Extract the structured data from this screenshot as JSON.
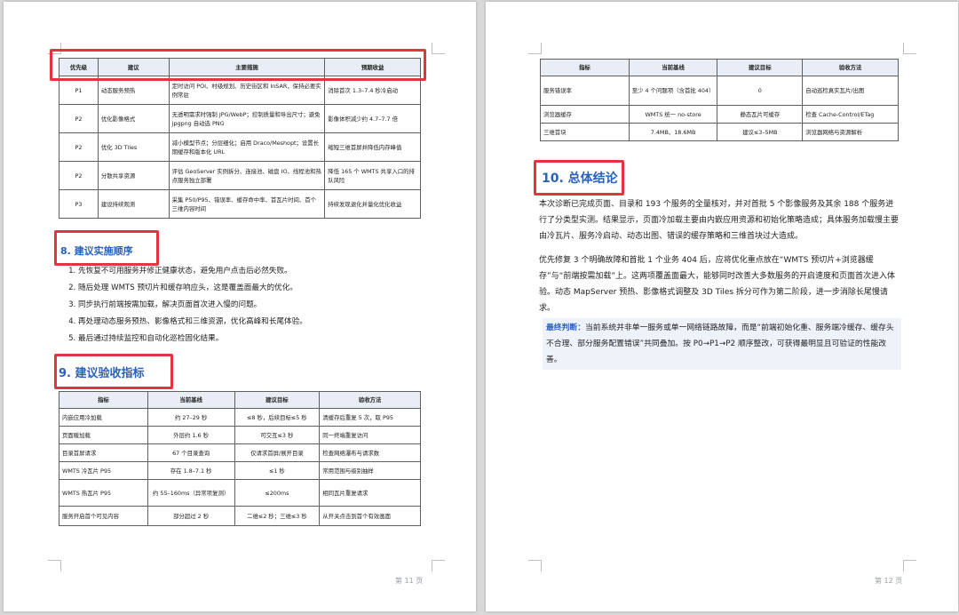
{
  "pages": [
    {
      "footer": "第 11 页",
      "table1": {
        "headers": [
          "优先级",
          "建议",
          "主要措施",
          "预期收益"
        ],
        "rows": [
          [
            "P1",
            "动态服务预热",
            "定时访问 POI、村级规划、历史街区和 InSAR，保持必要实例常驻",
            "消除首次 1.3–7.4 秒冷启动"
          ],
          [
            "P2",
            "优化影像格式",
            "无透明需求时强制 JPG/WebP；控制质量和导出尺寸；避免 jpgpng 自动选 PNG",
            "影像体积减少约 4.7–7.7 倍"
          ],
          [
            "P2",
            "优化 3D Tiles",
            "减小模型节点；分层细化；启用 Draco/Meshopt；设置长期缓存和版本化 URL",
            "缩短三维首屏并降低内存峰值"
          ],
          [
            "P2",
            "分散共享资源",
            "评估 GeoServer 实例拆分、连接池、磁盘 IO、线程池和热点服务独立部署",
            "降低 165 个 WMTS 共享入口的排队风险"
          ],
          [
            "P3",
            "建设持续观测",
            "采集 P50/P95、错误率、缓存命中率、首瓦片时间、首个三维内容时间",
            "持续发现退化并量化优化收益"
          ]
        ]
      },
      "section8": {
        "title": "8. 建议实施顺序",
        "items": [
          "先恢复不可用服务并修正健康状态，避免用户点击后必然失败。",
          "随后处理 WMTS 预切片和缓存响应头，这是覆盖面最大的优化。",
          "同步执行前端按需加载，解决页面首次进入慢的问题。",
          "再处理动态服务预热、影像格式和三维资源，优化高峰和长尾体验。",
          "最后通过持续监控和自动化巡检固化结果。"
        ]
      },
      "section9": {
        "title": "9. 建议验收指标",
        "headers": [
          "指标",
          "当前基线",
          "建议目标",
          "验收方法"
        ],
        "rows": [
          [
            "内嵌应用冷加载",
            "约 27–29 秒",
            "≤8 秒，后续目标≤5 秒",
            "清缓存后重复 5 次，取 P95"
          ],
          [
            "页面暖加载",
            "外层约 1.6 秒",
            "可交互≤3 秒",
            "同一终端重复访问"
          ],
          [
            "目录首屏请求",
            "67 个目录查询",
            "仅请求首屏/展开目录",
            "检查网络瀑布与请求数"
          ],
          [
            "WMTS 冷瓦片 P95",
            "存在 1.8–7.1 秒",
            "≤1 秒",
            "常用范围与级别抽样"
          ],
          [
            "WMTS 热瓦片 P95",
            "约 55–160ms（异常项复测）",
            "≤200ms",
            "相同瓦片重复请求"
          ],
          [
            "服务开启首个可见内容",
            "部分超过 2 秒",
            "二维≤2 秒；三维≤3 秒",
            "从开关点击到首个有效画面"
          ]
        ]
      }
    },
    {
      "footer": "第 12 页",
      "table_cont": {
        "headers": [
          "指标",
          "当前基线",
          "建议目标",
          "验收方法"
        ],
        "rows": [
          [
            "服务错误率",
            "至少 4 个问题项（含首批 404）",
            "0",
            "自动巡检真实瓦片/出图"
          ],
          [
            "浏览器缓存",
            "WMTS 统一 no-store",
            "静态瓦片可缓存",
            "检查 Cache-Control/ETag"
          ],
          [
            "三维首块",
            "7.4MB、18.6MB",
            "建议≤3–5MB",
            "浏览器网络与资源解析"
          ]
        ]
      },
      "section10": {
        "title": "10. 总体结论",
        "para1": "本次诊断已完成页面、目录和 193 个服务的全量核对，并对首批 5 个影像服务及其余 188 个服务进行了分类型实测。结果显示，页面冷加载主要由内嵌应用资源和初始化策略造成；具体服务加载慢主要由冷瓦片、服务冷启动、动态出图、错误的缓存策略和三维首块过大造成。",
        "para2": "优先修复 3 个明确故障和首批 1 个业务 404 后，应将优化重点放在“WMTS 预切片+浏览器缓存”与“前端按需加载”上。这两项覆盖面最大，能够同时改善大多数服务的开启速度和页面首次进入体验。动态 MapServer 预热、影像格式调整及 3D Tiles 拆分可作为第二阶段，进一步消除长尾慢请求。",
        "note_label": "最终判断：",
        "note_text": "当前系统并非单一服务或单一网络链路故障，而是“前端初始化重、服务端冷缓存、缓存头不合理、部分服务配置错误”共同叠加。按 P0→P1→P2 顺序整改，可获得最明显且可验证的性能改善。"
      }
    }
  ]
}
